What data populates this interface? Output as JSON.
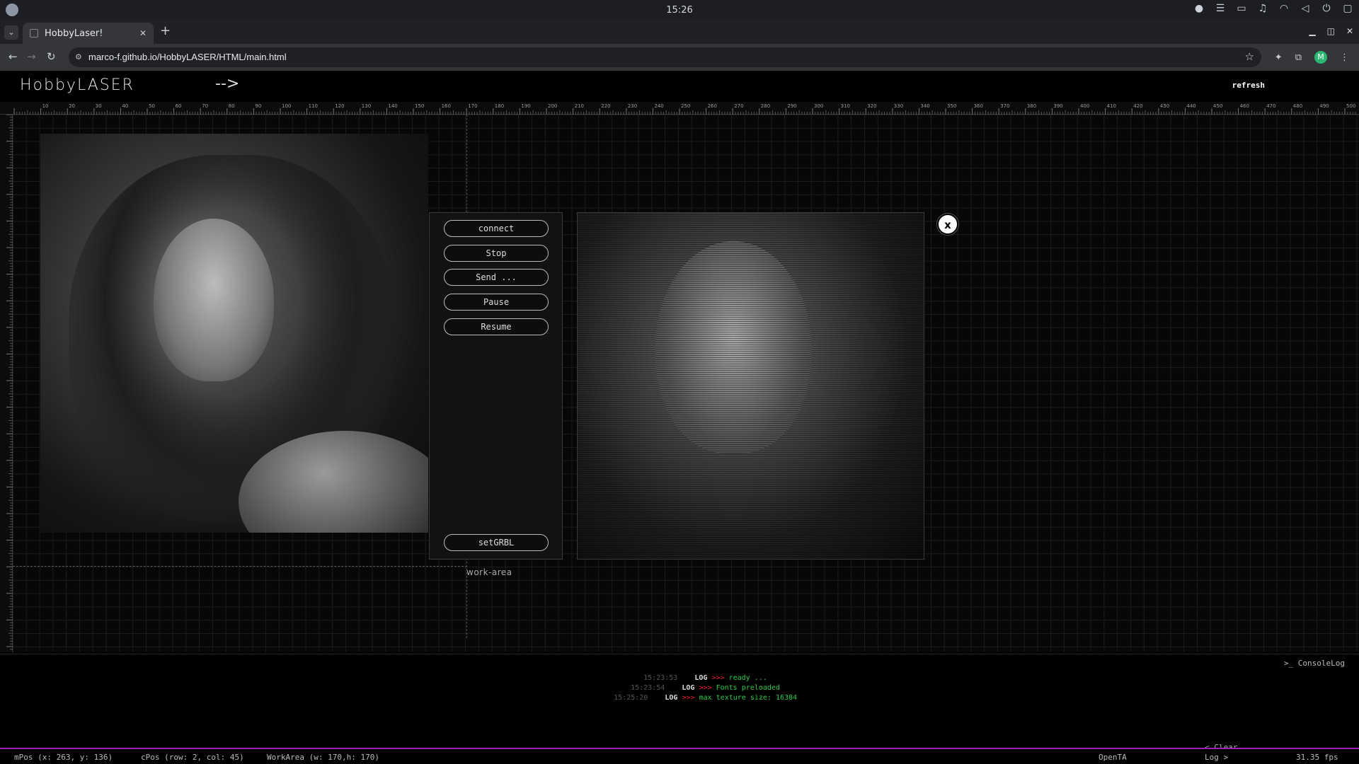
{
  "os": {
    "clock": "15:26"
  },
  "browser": {
    "tab_title": "HobbyLaser!",
    "url": "marco-f.github.io/HobbyLASER/HTML/main.html",
    "profile_initial": "M"
  },
  "app": {
    "logo": "HobbyLASER",
    "arrow": "-->",
    "refresh_label": "refresh",
    "work_area_label": "work-area",
    "controls": [
      "connect",
      "Stop",
      "Send ...",
      "Pause",
      "Resume",
      "setGRBL"
    ],
    "close_label": "x"
  },
  "console": {
    "title": ">_ ConsoleLog",
    "logs": [
      {
        "time": "15:23:53",
        "tag": "LOG",
        "arrow": ">>>",
        "msg": "ready ..."
      },
      {
        "time": "15:23:54",
        "tag": "LOG",
        "arrow": ">>>",
        "msg": "Fonts preloaded"
      },
      {
        "time": "15:25:20",
        "tag": "LOG",
        "arrow": ">>>",
        "msg": "max texture size: 16384"
      }
    ],
    "clear_label": "< Clear"
  },
  "status": {
    "mpos": "mPos (x: 263, y: 136)",
    "cpos": "cPos (row: 2, col: 45)",
    "workarea": "WorkArea (w: 170,h: 170)",
    "open_ta": "OpenTA",
    "log_toggle": "Log >",
    "fps": "31.35 fps"
  },
  "colors": {
    "status_border": "#9b1fb7",
    "log_msg": "#2fcc48",
    "log_arrow": "#e23"
  }
}
